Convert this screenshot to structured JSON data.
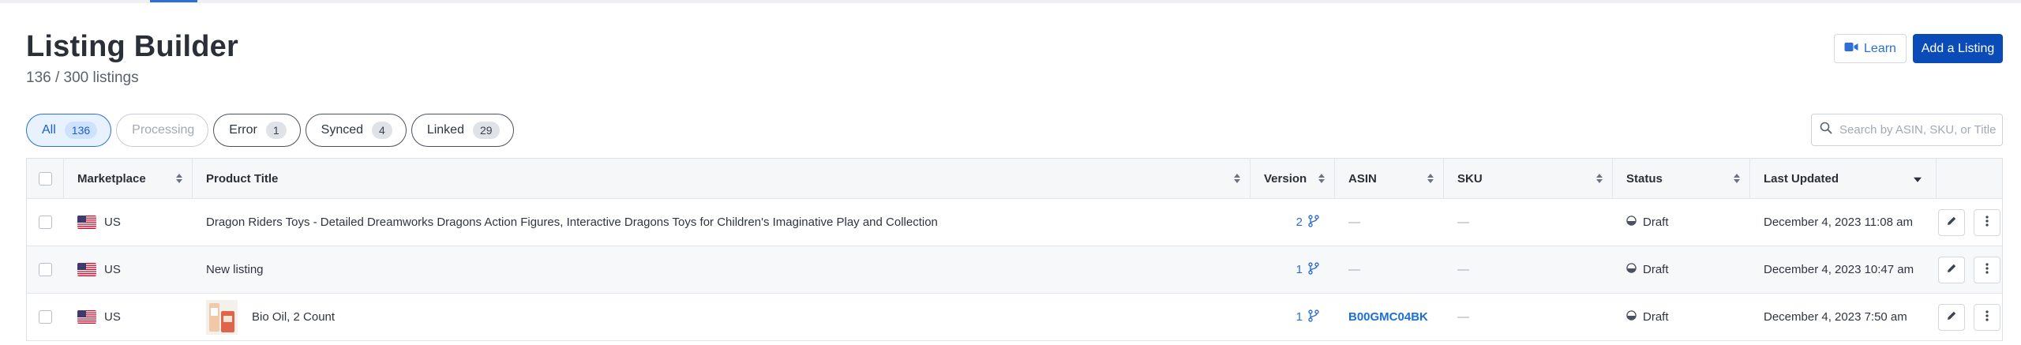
{
  "page": {
    "title": "Listing Builder",
    "subtitle": "136 / 300 listings",
    "learn_label": "Learn",
    "add_label": "Add a Listing"
  },
  "filters": [
    {
      "label": "All",
      "count": "136",
      "state": "active"
    },
    {
      "label": "Processing",
      "count": "",
      "state": "disabled"
    },
    {
      "label": "Error",
      "count": "1",
      "state": "normal"
    },
    {
      "label": "Synced",
      "count": "4",
      "state": "normal"
    },
    {
      "label": "Linked",
      "count": "29",
      "state": "normal"
    }
  ],
  "search": {
    "placeholder": "Search by ASIN, SKU, or Title"
  },
  "table": {
    "headers": {
      "marketplace": "Marketplace",
      "title": "Product Title",
      "version": "Version",
      "asin": "ASIN",
      "sku": "SKU",
      "status": "Status",
      "updated": "Last Updated"
    },
    "rows": [
      {
        "marketplace": "US",
        "title": "Dragon Riders Toys - Detailed Dreamworks Dragons Action Figures, Interactive Dragons Toys for Children's Imaginative Play and Collection",
        "version": "2",
        "asin": "—",
        "sku": "—",
        "status": "Draft",
        "updated": "December 4, 2023 11:08 am"
      },
      {
        "marketplace": "US",
        "title": "New listing",
        "version": "1",
        "asin": "—",
        "sku": "—",
        "status": "Draft",
        "updated": "December 4, 2023 10:47 am"
      },
      {
        "marketplace": "US",
        "title": "Bio Oil, 2 Count",
        "version": "1",
        "asin": "B00GMC04BK",
        "sku": "—",
        "status": "Draft",
        "updated": "December 4, 2023 7:50 am"
      }
    ]
  },
  "colors": {
    "accent": "#2d6fd6",
    "primary_button": "#0a4bb8"
  }
}
